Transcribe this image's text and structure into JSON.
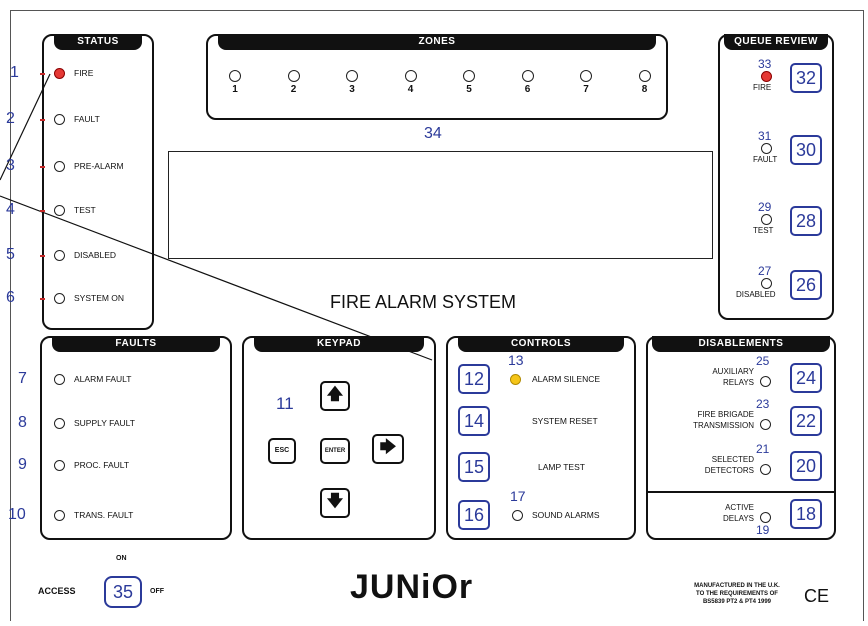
{
  "colors": {
    "label_blue": "#2b3a9a",
    "fire_red": "#e53935",
    "silence_yellow": "#f5c518"
  },
  "status": {
    "title": "STATUS",
    "items": [
      {
        "num": "1",
        "label": "FIRE",
        "led": "red"
      },
      {
        "num": "2",
        "label": "FAULT",
        "led": "off"
      },
      {
        "num": "3",
        "label": "PRE-ALARM",
        "led": "off"
      },
      {
        "num": "4",
        "label": "TEST",
        "led": "off"
      },
      {
        "num": "5",
        "label": "DISABLED",
        "led": "off"
      },
      {
        "num": "6",
        "label": "SYSTEM ON",
        "led": "off"
      }
    ]
  },
  "zones": {
    "title": "ZONES",
    "labels": [
      "1",
      "2",
      "3",
      "4",
      "5",
      "6",
      "7",
      "8"
    ],
    "num": "34"
  },
  "queue": {
    "title": "QUEUE REVIEW",
    "items": [
      {
        "led_num": "33",
        "label": "FIRE",
        "btn": "32",
        "led": "red"
      },
      {
        "led_num": "31",
        "label": "FAULT",
        "btn": "30",
        "led": "off"
      },
      {
        "led_num": "29",
        "label": "TEST",
        "btn": "28",
        "led": "off"
      },
      {
        "led_num": "27",
        "label": "DISABLED",
        "btn": "26",
        "led": "off"
      }
    ]
  },
  "system_title": "FIRE ALARM SYSTEM",
  "faults": {
    "title": "FAULTS",
    "items": [
      {
        "num": "7",
        "label": "ALARM FAULT"
      },
      {
        "num": "8",
        "label": "SUPPLY FAULT"
      },
      {
        "num": "9",
        "label": "PROC. FAULT"
      },
      {
        "num": "10",
        "label": "TRANS. FAULT"
      }
    ]
  },
  "keypad": {
    "title": "KEYPAD",
    "num": "11",
    "esc": "ESC",
    "enter": "ENTER",
    "up": "🡅",
    "down": "🡇",
    "right": "🡆"
  },
  "controls": {
    "title": "CONTROLS",
    "led_num_silence": "13",
    "led_num_sound": "17",
    "items": [
      {
        "btn": "12",
        "label": "ALARM SILENCE"
      },
      {
        "btn": "14",
        "label": "SYSTEM RESET"
      },
      {
        "btn": "15",
        "label": "LAMP TEST"
      },
      {
        "btn": "16",
        "label": "SOUND ALARMS"
      }
    ]
  },
  "disablements": {
    "title": "DISABLEMENTS",
    "items": [
      {
        "label1": "AUXILIARY",
        "label2": "RELAYS",
        "led_num": "25",
        "btn": "24"
      },
      {
        "label1": "FIRE BRIGADE",
        "label2": "TRANSMISSION",
        "led_num": "23",
        "btn": "22"
      },
      {
        "label1": "SELECTED",
        "label2": "DETECTORS",
        "led_num": "21",
        "btn": "20"
      },
      {
        "label1": "ACTIVE",
        "label2": "DELAYS",
        "led_num": "19",
        "btn": "18"
      }
    ]
  },
  "access": {
    "label": "ACCESS",
    "num": "35",
    "on": "ON",
    "off": "OFF"
  },
  "brand": "JUNiOr",
  "footer": {
    "line1": "MANUFACTURED IN THE U.K.",
    "line2": "TO THE REQUIREMENTS OF",
    "line3": "BS5839 PT2 & PT4 1999",
    "ce": "CE"
  }
}
